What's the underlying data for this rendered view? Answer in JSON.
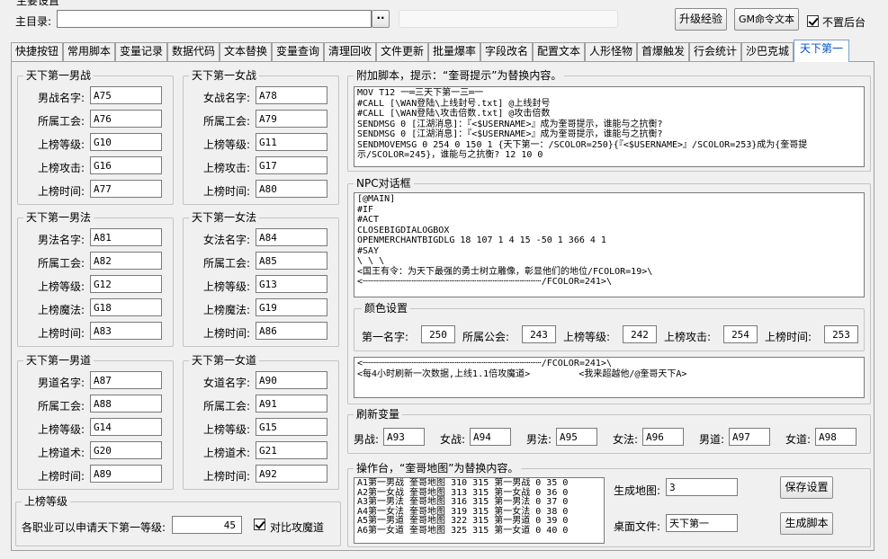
{
  "header": {
    "title_partial": "主要设置",
    "main_dir_label": "主目录:",
    "main_dir_value": "",
    "browse_label": "··",
    "upgrade_btn": "升级经验",
    "gm_btn": "GM命令文本",
    "topmost_label": "不置后台",
    "topmost_checked": true
  },
  "tabs": [
    "快捷按钮",
    "常用脚本",
    "变量记录",
    "数据代码",
    "文本替换",
    "变量查询",
    "清理回收",
    "文件更新",
    "批量爆率",
    "字段改名",
    "配置文本",
    "人形怪物",
    "首爆触发",
    "行会统计",
    "沙巴克城",
    "天下第一"
  ],
  "active_tab": 15,
  "groups": {
    "male_warrior": {
      "caption": "天下第一男战",
      "fields": [
        {
          "label": "男战名字:",
          "value": "A75"
        },
        {
          "label": "所属工会:",
          "value": "A76"
        },
        {
          "label": "上榜等级:",
          "value": "G10"
        },
        {
          "label": "上榜攻击:",
          "value": "G16"
        },
        {
          "label": "上榜时间:",
          "value": "A77"
        }
      ]
    },
    "female_warrior": {
      "caption": "天下第一女战",
      "fields": [
        {
          "label": "女战名字:",
          "value": "A78"
        },
        {
          "label": "所属工会:",
          "value": "A79"
        },
        {
          "label": "上榜等级:",
          "value": "G11"
        },
        {
          "label": "上榜攻击:",
          "value": "G17"
        },
        {
          "label": "上榜时间:",
          "value": "A80"
        }
      ]
    },
    "male_mage": {
      "caption": "天下第一男法",
      "fields": [
        {
          "label": "男法名字:",
          "value": "A81"
        },
        {
          "label": "所属工会:",
          "value": "A82"
        },
        {
          "label": "上榜等级:",
          "value": "G12"
        },
        {
          "label": "上榜魔法:",
          "value": "G18"
        },
        {
          "label": "上榜时间:",
          "value": "A83"
        }
      ]
    },
    "female_mage": {
      "caption": "天下第一女法",
      "fields": [
        {
          "label": "女法名字:",
          "value": "A84"
        },
        {
          "label": "所属工会:",
          "value": "A85"
        },
        {
          "label": "上榜等级:",
          "value": "G13"
        },
        {
          "label": "上榜魔法:",
          "value": "G19"
        },
        {
          "label": "上榜时间:",
          "value": "A86"
        }
      ]
    },
    "male_taoist": {
      "caption": "天下第一男道",
      "fields": [
        {
          "label": "男道名字:",
          "value": "A87"
        },
        {
          "label": "所属工会:",
          "value": "A88"
        },
        {
          "label": "上榜等级:",
          "value": "G14"
        },
        {
          "label": "上榜道术:",
          "value": "G20"
        },
        {
          "label": "上榜时间:",
          "value": "A89"
        }
      ]
    },
    "female_taoist": {
      "caption": "天下第一女道",
      "fields": [
        {
          "label": "女道名字:",
          "value": "A90"
        },
        {
          "label": "所属工会:",
          "value": "A91"
        },
        {
          "label": "上榜等级:",
          "value": "G15"
        },
        {
          "label": "上榜道术:",
          "value": "G21"
        },
        {
          "label": "上榜时间:",
          "value": "A92"
        }
      ]
    }
  },
  "level_group": {
    "caption": "上榜等级",
    "label": "各职业可以申请天下第一等级:",
    "value": "45",
    "check_label": "对比攻魔道",
    "checked": true
  },
  "extra_script": {
    "caption": "附加脚本，提示：“奎哥提示”为替换内容。",
    "text": "MOV T12 一═三天下第一三═一\n#CALL [\\WAN登陆\\上线封号.txt] @上线封号\n#CALL [\\WAN登陆\\攻击倍数.txt] @攻击倍数\nSENDMSG 0 [江湖消息]：『<$USERNAME>』成为奎哥提示，谁能与之抗衡?\nSENDMSG 0 [江湖消息]：『<$USERNAME>』成为奎哥提示，谁能与之抗衡?\nSENDMOVEMSG 0 254 0 150 1 {天下第一：/SCOLOR=250}{『<$USERNAME>』/SCOLOR=253}成为{奎哥提\n示/SCOLOR=245}，谁能与之抗衡? 12 10 0"
  },
  "npc_dialog": {
    "caption": "NPC对话框",
    "text": "[@MAIN]\n#IF\n#ACT\nCLOSEBIGDIALOGBOX\nOPENMERCHANTBIGDLG 18 107 1 4 15 -50 1 366 4 1\n#SAY\n\\ \\ \\\n<国王有令：为天下最强的勇士树立雕像，彰显他们的地位/FCOLOR=19>\\\n<┄┄┄┄┄┄┄┄┄┄┄┄┄┄┄┄┄┄┄┄┄┄┄┄┄┄┄┄┄┄┄┄┄/FCOLOR=241>\\",
    "text2": "<┄┄┄┄┄┄┄┄┄┄┄┄┄┄┄┄┄┄┄┄┄┄┄┄┄┄┄┄┄┄┄┄┄/FCOLOR=241>\\\n<每4小时刷新一次数据,上线1.1倍攻魔道>         <我来超越他/@奎哥天下A>"
  },
  "color_settings": {
    "caption": "颜色设置",
    "items": [
      {
        "label": "第一名字:",
        "value": "250"
      },
      {
        "label": "所属公会:",
        "value": "243"
      },
      {
        "label": "上榜等级:",
        "value": "242"
      },
      {
        "label": "上榜攻击:",
        "value": "254"
      },
      {
        "label": "上榜时间:",
        "value": "253"
      }
    ]
  },
  "refresh_vars": {
    "caption": "刷新变量",
    "items": [
      {
        "label": "男战:",
        "value": "A93"
      },
      {
        "label": "女战:",
        "value": "A94"
      },
      {
        "label": "男法:",
        "value": "A95"
      },
      {
        "label": "女法:",
        "value": "A96"
      },
      {
        "label": "男道:",
        "value": "A97"
      },
      {
        "label": "女道:",
        "value": "A98"
      }
    ]
  },
  "console": {
    "caption": "操作台，“奎哥地图”为替换内容。",
    "text": "A1第一男战 奎哥地图 310 315 第一男战 0 35 0\nA2第一女战 奎哥地图 313 315 第一女战 0 36 0\nA3第一男法 奎哥地图 316 315 第一男法 0 37 0\nA4第一女法 奎哥地图 319 315 第一女法 0 38 0\nA5第一男道 奎哥地图 322 315 第一男道 0 39 0\nA6第一女道 奎哥地图 325 315 第一女道 0 40 0",
    "map_label": "生成地图:",
    "map_value": "3",
    "desk_label": "桌面文件:",
    "desk_value": "天下第一",
    "save_btn": "保存设置",
    "gen_btn": "生成脚本"
  }
}
